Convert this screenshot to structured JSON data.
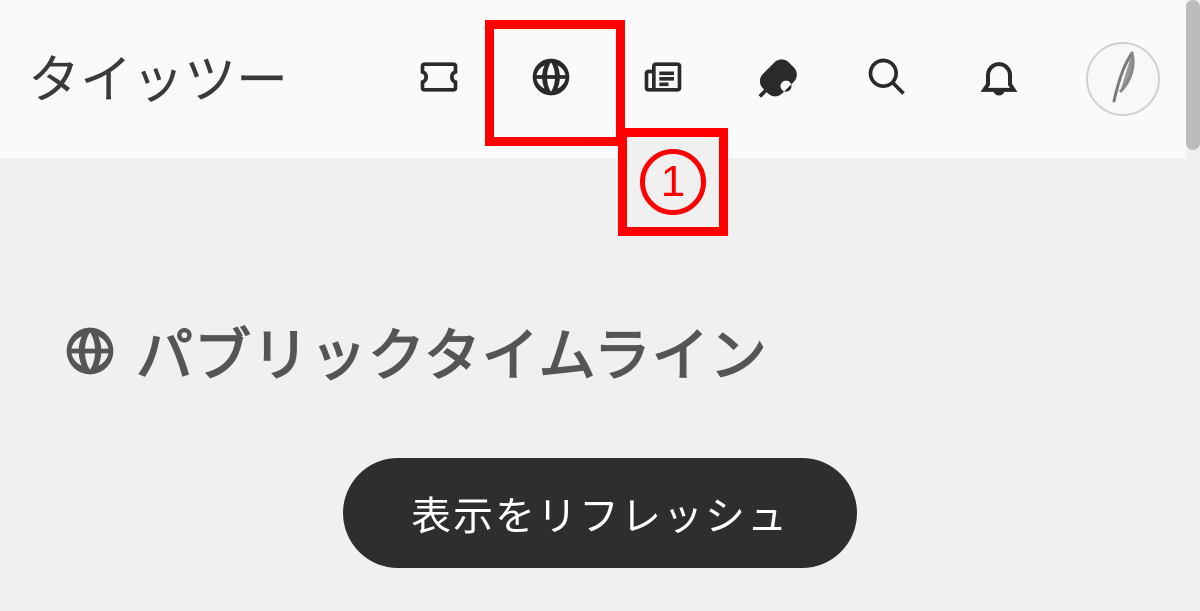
{
  "header": {
    "logo": "タイッツー",
    "icons": {
      "ticket": "ticket-icon",
      "globe": "globe-icon",
      "news": "news-icon",
      "paddle": "paddle-icon",
      "search": "search-icon",
      "bell": "bell-icon"
    }
  },
  "annotation": {
    "number": "1"
  },
  "main": {
    "title_icon": "globe-icon",
    "title": "パブリックタイムライン",
    "refresh_label": "表示をリフレッシュ"
  }
}
